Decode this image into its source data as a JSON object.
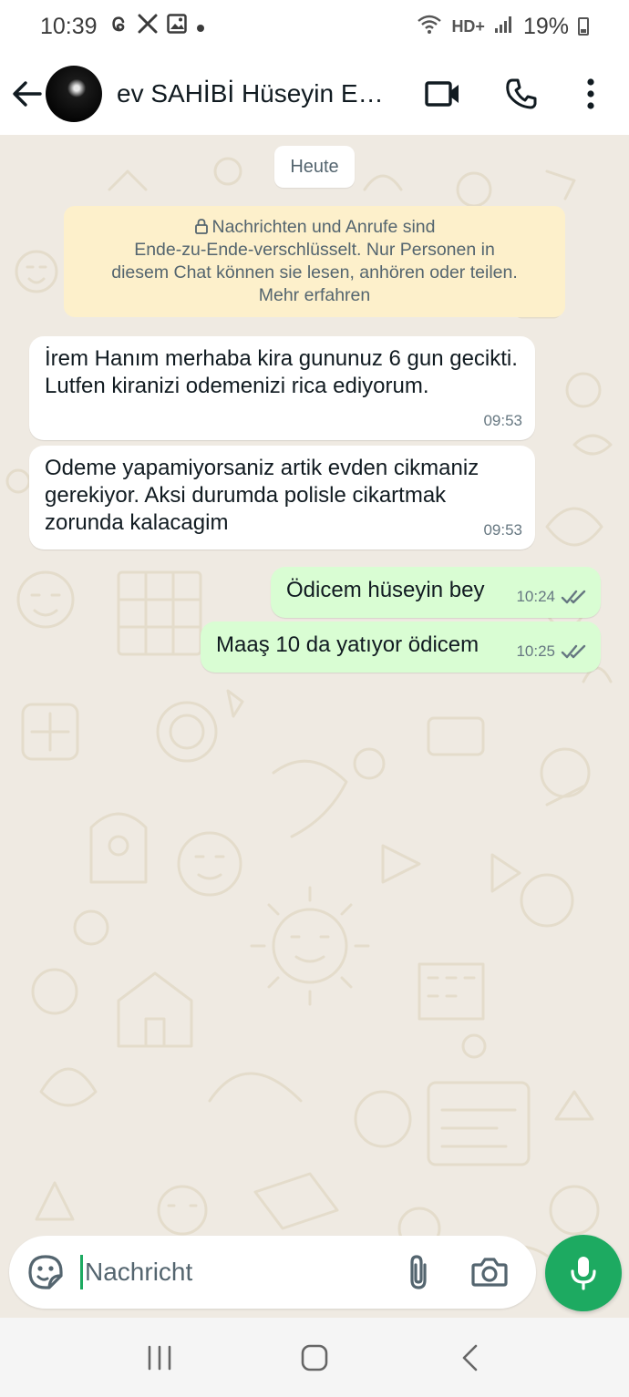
{
  "status_bar": {
    "time": "10:39",
    "notification_icons": [
      "threads-icon",
      "x-icon",
      "gallery-icon",
      "dot-icon"
    ],
    "network_label": "HD+",
    "battery": "19%"
  },
  "header": {
    "contact_name": "ev SAHİBİ Hüseyin Emla...",
    "icons": [
      "back-arrow-icon",
      "video-call-icon",
      "phone-icon",
      "more-options-icon"
    ]
  },
  "chat": {
    "date_chip": "Heute",
    "encryption_notice": {
      "line1": "Nachrichten und Anrufe sind",
      "line2": "Ende-zu-Ende-verschlüsselt. Nur Personen in",
      "line3": "diesem Chat können sie lesen, anhören oder teilen.",
      "line4": "Mehr erfahren"
    },
    "messages": [
      {
        "direction": "incoming",
        "text": "İrem Hanım merhaba kira gununuz 6 gun gecikti. Lutfen kiranizi odemenizi rica ediyorum.",
        "time": "09:53"
      },
      {
        "direction": "incoming",
        "text": "Odeme yapamiyorsaniz artik evden cikmaniz gerekiyor. Aksi durumda polisle cikartmak zorunda kalacagim",
        "time": "09:53"
      },
      {
        "direction": "outgoing",
        "text": "Ödicem hüseyin bey",
        "time": "10:24",
        "status": "read"
      },
      {
        "direction": "outgoing",
        "text": "Maaş 10 da yatıyor ödicem",
        "time": "10:25",
        "status": "read"
      }
    ]
  },
  "composer": {
    "placeholder": "Nachricht",
    "icons": [
      "sticker-icon",
      "attach-icon",
      "camera-icon",
      "microphone-icon"
    ]
  },
  "nav": {
    "icons": [
      "recent-apps-icon",
      "home-icon",
      "back-icon"
    ]
  },
  "colors": {
    "chat_background": "#efeae2",
    "incoming_bubble": "#ffffff",
    "outgoing_bubble": "#d9fdd3",
    "accent_green": "#1daa61",
    "notice_background": "#fdf0cb",
    "read_tick": "#667781"
  }
}
